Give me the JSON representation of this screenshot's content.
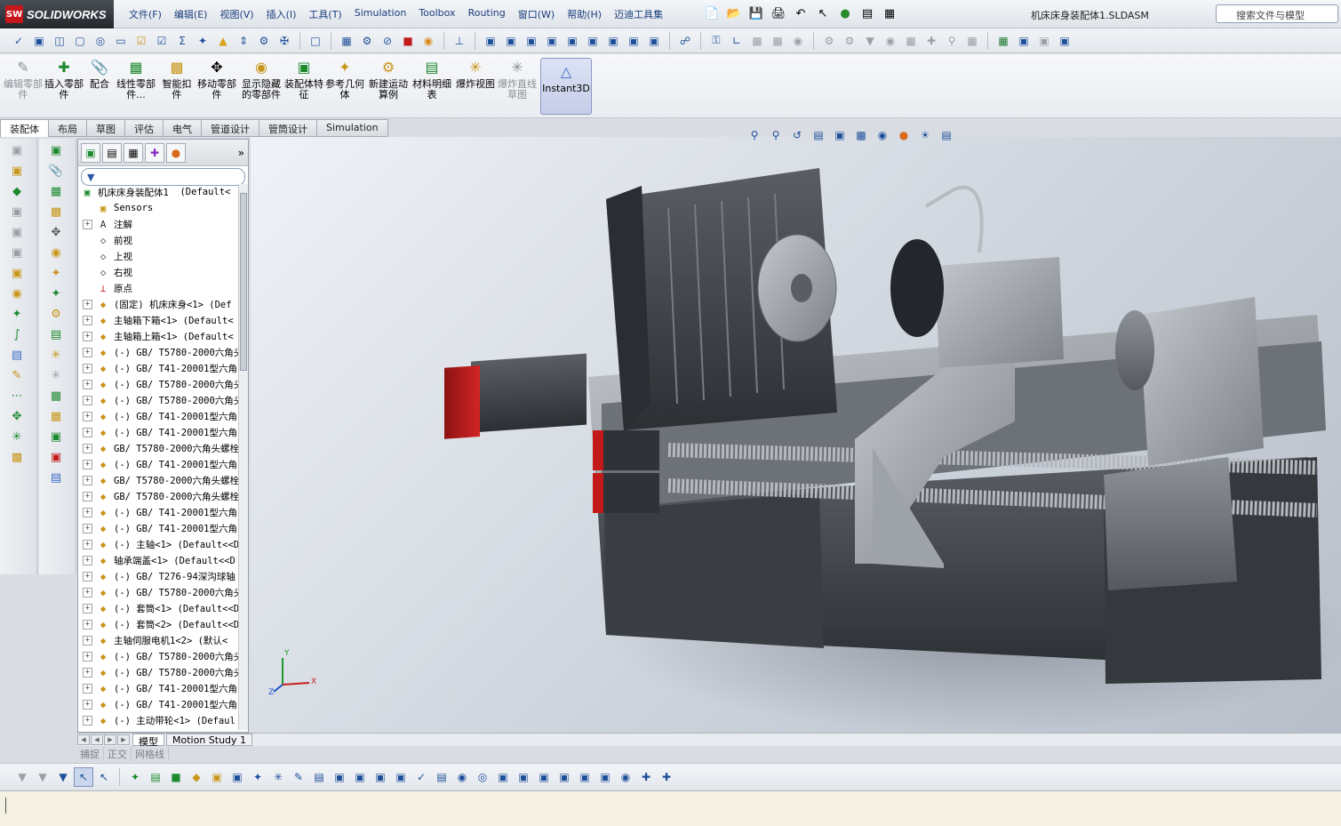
{
  "app": {
    "logo_ds": "SW",
    "logo_text": "SOLIDWORKS"
  },
  "menu": [
    "文件(F)",
    "编辑(E)",
    "视图(V)",
    "插入(I)",
    "工具(T)",
    "Simulation",
    "Toolbox",
    "Routing",
    "窗口(W)",
    "帮助(H)",
    "迈迪工具集"
  ],
  "document_title": "机床床身装配体1.SLDASM",
  "search": {
    "placeholder": "搜索文件与模型"
  },
  "command_manager": {
    "buttons": [
      {
        "label": "编辑零部件",
        "disabled": true,
        "icon": "edit-component-icon"
      },
      {
        "label": "插入零部件",
        "icon": "insert-component-icon"
      },
      {
        "label": "配合",
        "icon": "mate-icon"
      },
      {
        "label": "线性零部件...",
        "icon": "linear-pattern-icon"
      },
      {
        "label": "智能扣件",
        "icon": "smart-fasteners-icon"
      },
      {
        "label": "移动零部件",
        "icon": "move-component-icon"
      },
      {
        "label": "显示隐藏的零部件",
        "icon": "show-hidden-icon"
      },
      {
        "label": "装配体特征",
        "icon": "assembly-features-icon"
      },
      {
        "label": "参考几何体",
        "icon": "reference-geometry-icon"
      },
      {
        "label": "新建运动算例",
        "icon": "motion-study-icon"
      },
      {
        "label": "材料明细表",
        "icon": "bom-icon"
      },
      {
        "label": "爆炸视图",
        "icon": "exploded-view-icon"
      },
      {
        "label": "爆炸直线草图",
        "disabled": true,
        "icon": "explode-line-sketch-icon"
      },
      {
        "label": "Instant3D",
        "active": true,
        "icon": "instant3d-icon"
      }
    ]
  },
  "tabs": [
    "装配体",
    "布局",
    "草图",
    "评估",
    "电气",
    "管道设计",
    "管筒设计",
    "Simulation"
  ],
  "active_tab": "装配体",
  "feature_tree": {
    "root": {
      "name": "机床床身装配体1",
      "config": "(Default<"
    },
    "items": [
      {
        "label": "Sensors",
        "icon": "sensors-icon",
        "expand": false
      },
      {
        "label": "注解",
        "icon": "annotations-icon",
        "expand": true
      },
      {
        "label": "前视",
        "icon": "plane-icon",
        "expand": false
      },
      {
        "label": "上视",
        "icon": "plane-icon",
        "expand": false
      },
      {
        "label": "右视",
        "icon": "plane-icon",
        "expand": false
      },
      {
        "label": "原点",
        "icon": "origin-icon",
        "expand": false
      },
      {
        "label": "(固定) 机床床身<1> (Def",
        "icon": "part-icon",
        "expand": true
      },
      {
        "label": "主轴箱下箱<1> (Default<",
        "icon": "part-icon",
        "expand": true
      },
      {
        "label": "主轴箱上箱<1> (Default<",
        "icon": "part-icon",
        "expand": true
      },
      {
        "label": "(-) GB/ T5780-2000六角头",
        "icon": "part-icon",
        "expand": true
      },
      {
        "label": "(-) GB/ T41-20001型六角",
        "icon": "part-icon",
        "expand": true
      },
      {
        "label": "(-) GB/ T5780-2000六角头",
        "icon": "part-icon",
        "expand": true
      },
      {
        "label": "(-) GB/ T5780-2000六角头",
        "icon": "part-icon",
        "expand": true
      },
      {
        "label": "(-) GB/ T41-20001型六角",
        "icon": "part-icon",
        "expand": true
      },
      {
        "label": "(-) GB/ T41-20001型六角",
        "icon": "part-icon",
        "expand": true
      },
      {
        "label": "GB/ T5780-2000六角头螺栓",
        "icon": "part-icon",
        "expand": true
      },
      {
        "label": "(-) GB/ T41-20001型六角",
        "icon": "part-icon",
        "expand": true
      },
      {
        "label": "GB/ T5780-2000六角头螺栓",
        "icon": "part-icon",
        "expand": true
      },
      {
        "label": "GB/ T5780-2000六角头螺栓",
        "icon": "part-icon",
        "expand": true
      },
      {
        "label": "(-) GB/ T41-20001型六角",
        "icon": "part-icon",
        "expand": true
      },
      {
        "label": "(-) GB/ T41-20001型六角",
        "icon": "part-icon",
        "expand": true
      },
      {
        "label": "(-) 主轴<1> (Default<<D",
        "icon": "part-icon",
        "expand": true
      },
      {
        "label": "轴承端盖<1> (Default<<D",
        "icon": "part-icon",
        "expand": true
      },
      {
        "label": "(-) GB/ T276-94深沟球轴",
        "icon": "part-icon",
        "expand": true
      },
      {
        "label": "(-) GB/ T5780-2000六角头",
        "icon": "part-icon",
        "expand": true
      },
      {
        "label": "(-) 套筒<1> (Default<<D",
        "icon": "part-icon",
        "expand": true
      },
      {
        "label": "(-) 套筒<2> (Default<<D",
        "icon": "part-icon",
        "expand": true
      },
      {
        "label": "主轴伺服电机1<2> (默认<",
        "icon": "part-icon",
        "expand": true
      },
      {
        "label": "(-) GB/ T5780-2000六角头",
        "icon": "part-icon",
        "expand": true
      },
      {
        "label": "(-) GB/ T5780-2000六角头",
        "icon": "part-icon",
        "expand": true
      },
      {
        "label": "(-) GB/ T41-20001型六角",
        "icon": "part-icon",
        "expand": true
      },
      {
        "label": "(-) GB/ T41-20001型六角",
        "icon": "part-icon",
        "expand": true
      },
      {
        "label": "(-) 主动带轮<1> (Defaul",
        "icon": "part-icon",
        "expand": true
      }
    ]
  },
  "bottom_tabs": [
    "模型",
    "Motion Study 1"
  ],
  "snap_bar": [
    "捕捉",
    "正交",
    "网格线"
  ],
  "triad": {
    "x": "X",
    "y": "Y",
    "z": "Z"
  },
  "colors": {
    "motor_red": "#c21a1a",
    "machine_dark": "#3c3f44",
    "machine_light": "#9da3aa"
  }
}
